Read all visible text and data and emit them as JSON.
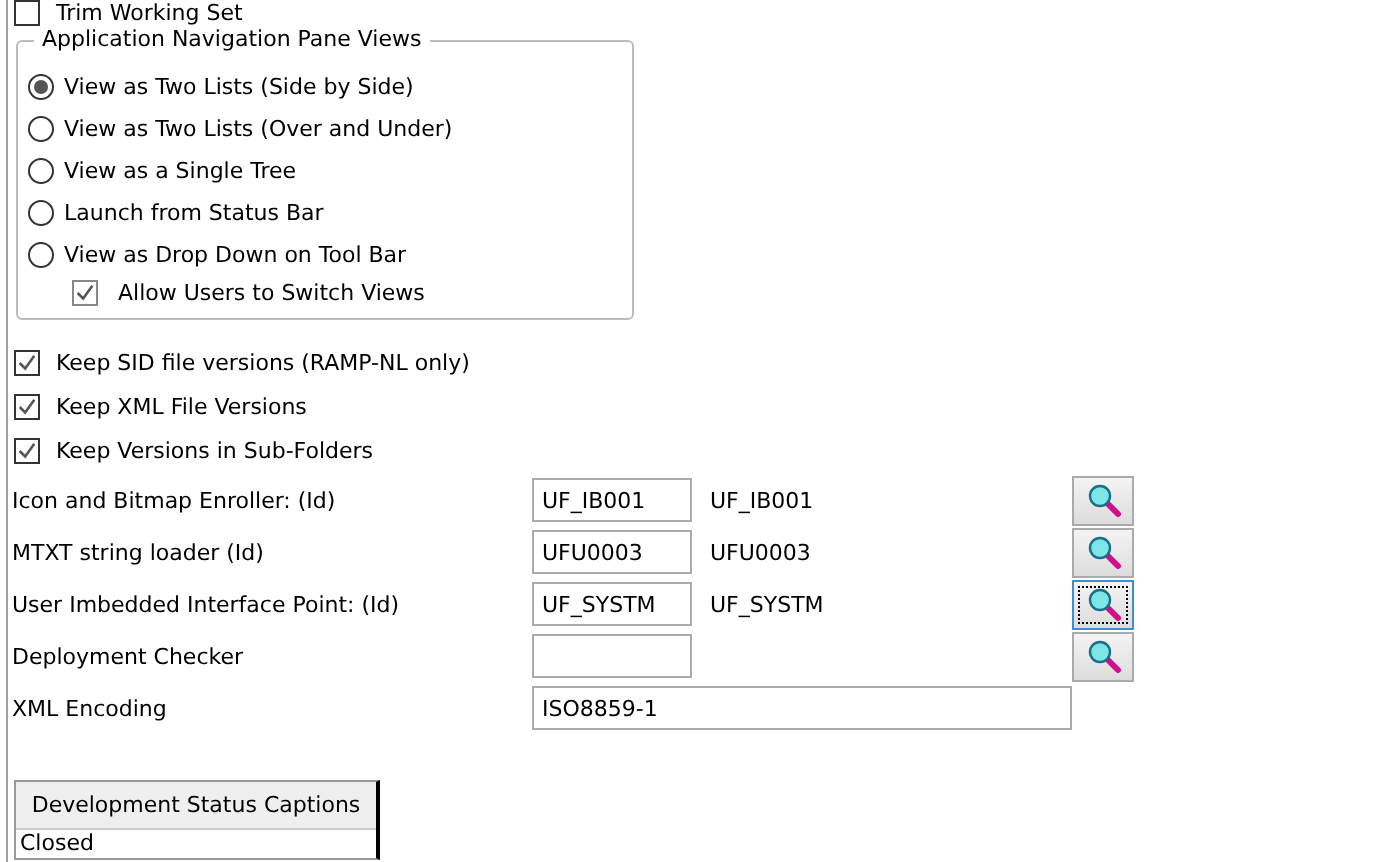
{
  "top_option": {
    "label": "Trim Working Set",
    "checked": false
  },
  "nav_group": {
    "title": "Application Navigation Pane Views",
    "options": [
      {
        "label": "View as Two Lists (Side by Side)",
        "selected": true
      },
      {
        "label": "View as Two Lists (Over and Under)",
        "selected": false
      },
      {
        "label": "View as a Single Tree",
        "selected": false
      },
      {
        "label": "Launch from Status Bar",
        "selected": false
      },
      {
        "label": "View as Drop Down on Tool Bar",
        "selected": false
      }
    ],
    "sub_option": {
      "label": "Allow Users to Switch Views",
      "checked": true
    }
  },
  "options": [
    {
      "label": "Keep SID file versions (RAMP-NL only)",
      "checked": true
    },
    {
      "label": "Keep XML File Versions",
      "checked": true
    },
    {
      "label": "Keep Versions in Sub-Folders",
      "checked": true
    }
  ],
  "fields": [
    {
      "label": "Icon and Bitmap Enroller: (Id)",
      "value": "UF_IB001",
      "display": "UF_IB001",
      "focused": false
    },
    {
      "label": "MTXT string loader (Id)",
      "value": "UFU0003",
      "display": "UFU0003",
      "focused": false
    },
    {
      "label": "User Imbedded Interface Point: (Id)",
      "value": "UF_SYSTM",
      "display": "UF_SYSTM",
      "focused": true
    },
    {
      "label": "Deployment Checker",
      "focused": false
    }
  ],
  "encoding": {
    "label": "XML Encoding",
    "value": "ISO8859-1"
  },
  "captions_table": {
    "header": "Development Status Captions",
    "rows": [
      "Closed"
    ]
  }
}
